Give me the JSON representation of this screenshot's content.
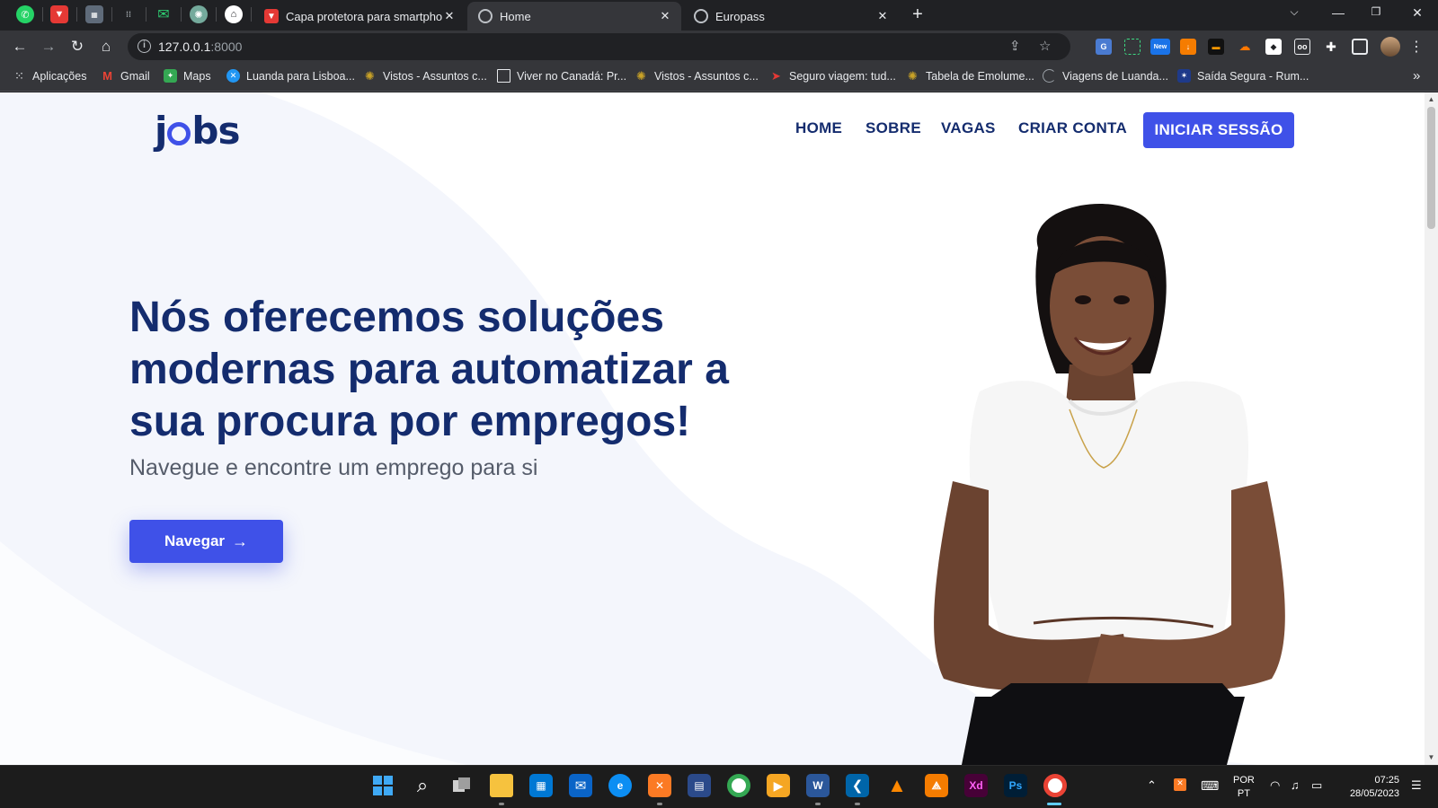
{
  "browser": {
    "pinned_tabs": [
      "whatsapp-icon",
      "youtube-icon",
      "cisco-icon",
      "cisco-icon",
      "mail-icon",
      "chatgpt-icon",
      "github-icon"
    ],
    "tabs": [
      {
        "title": "Capa protetora para smartphone",
        "favicon": "youtube-icon"
      },
      {
        "title": "Home",
        "favicon": "globe-icon",
        "active": true
      },
      {
        "title": "Europass",
        "favicon": "globe-icon"
      }
    ],
    "url_host": "127.0.0.1",
    "url_port": ":8000",
    "extension_badge": "New",
    "bookmarks": [
      {
        "label": "Aplicações",
        "icon": "apps-grid-icon"
      },
      {
        "label": "Gmail",
        "icon": "gmail-icon"
      },
      {
        "label": "Maps",
        "icon": "maps-icon"
      },
      {
        "label": "Luanda para Lisboa...",
        "icon": "flight-icon"
      },
      {
        "label": "Vistos - Assuntos c...",
        "icon": "emblem-icon"
      },
      {
        "label": "Viver no Canadá: Pr...",
        "icon": "page-icon"
      },
      {
        "label": "Vistos - Assuntos c...",
        "icon": "emblem-icon"
      },
      {
        "label": "Seguro viagem: tud...",
        "icon": "plane-icon"
      },
      {
        "label": "Tabela de Emolume...",
        "icon": "emblem-icon"
      },
      {
        "label": "Viagens de Luanda...",
        "icon": "loading-icon"
      },
      {
        "label": "Saída Segura - Rum...",
        "icon": "flag-icon"
      }
    ]
  },
  "site": {
    "logo_parts": [
      "j",
      "b",
      "s"
    ],
    "nav": [
      "HOME",
      "SOBRE",
      "VAGAS",
      "CRIAR CONTA"
    ],
    "login_label": "INICIAR SESSÃO",
    "hero_title": "Nós oferecemos soluções modernas para automatizar a sua procura por empregos!",
    "hero_subtitle": "Navegue e encontre um emprego para si",
    "hero_button": "Navegar",
    "colors": {
      "primary": "#3f51e8",
      "navy": "#142c6e",
      "blob": "#f4f6fc"
    }
  },
  "taskbar": {
    "apps": [
      "windows-start-icon",
      "search-icon",
      "task-view-icon",
      "file-explorer-icon",
      "store-icon",
      "mail-icon",
      "edge-icon",
      "xampp-icon",
      "photo-icon",
      "chrome-icon",
      "media-player-icon",
      "word-icon",
      "vscode-icon",
      "vlc-icon",
      "app-icon",
      "adobe-xd-icon",
      "photoshop-icon",
      "chrome-icon"
    ],
    "xd_label": "Xd",
    "ps_label": "Ps",
    "word_label": "W",
    "lang_line1": "POR",
    "lang_line2": "PT",
    "time": "07:25",
    "date": "28/05/2023"
  }
}
